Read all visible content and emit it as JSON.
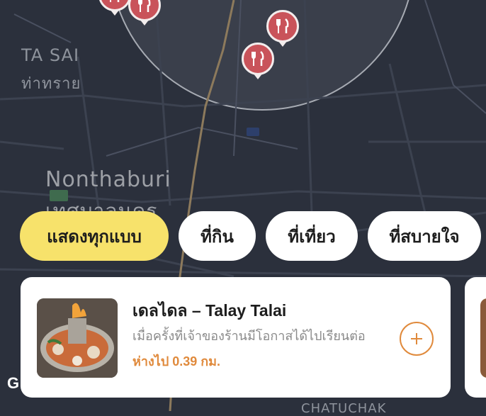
{
  "map": {
    "labels": [
      {
        "text": "TA SAI"
      },
      {
        "text": "ท่าทราย"
      },
      {
        "text": "Nonthaburi"
      },
      {
        "text": "เทศบาลนคร"
      },
      {
        "text": "CHATUCHAK"
      }
    ],
    "pins": [
      {
        "icon": "fork-knife-icon"
      },
      {
        "icon": "fork-knife-icon"
      },
      {
        "icon": "fork-knife-icon"
      },
      {
        "icon": "fork-knife-icon"
      }
    ],
    "logo_letter": "G"
  },
  "filters": [
    {
      "label": "แสดงทุกแบบ",
      "active": true
    },
    {
      "label": "ที่กิน",
      "active": false
    },
    {
      "label": "ที่เที่ยว",
      "active": false
    },
    {
      "label": "ที่สบายใจ",
      "active": false
    }
  ],
  "place_card": {
    "title": "เดลไดล – Talay Talai",
    "description": "เมื่อครั้งที่เจ้าของร้านมีโอกาสได้ไปเรียนต่อ",
    "distance": "ห่างไป 0.39 กม.",
    "add_icon": "plus-icon"
  },
  "colors": {
    "accent": "#f7e26b",
    "pin": "#c9535a",
    "distance": "#e08a3c",
    "map_bg": "#2b303c"
  }
}
